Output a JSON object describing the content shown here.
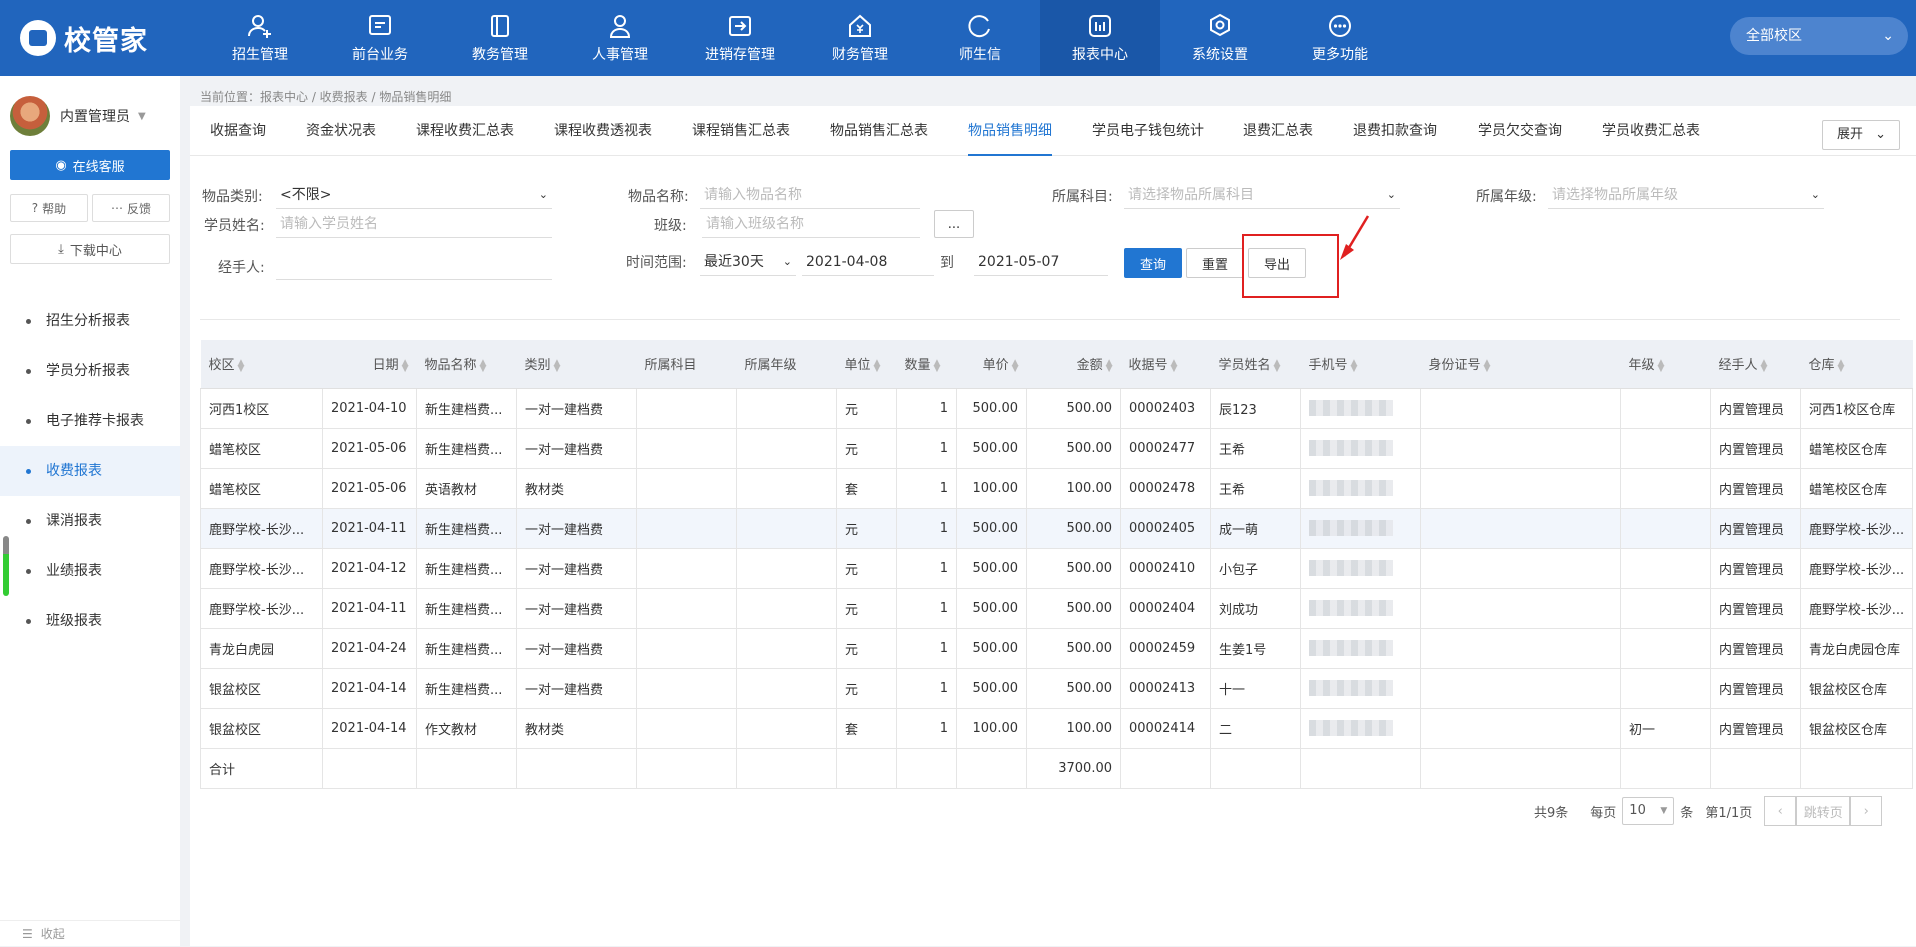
{
  "app": {
    "logo_text": "校管家",
    "campus_select": "全部校区"
  },
  "nav": [
    {
      "label": "招生管理",
      "icon": "user-plus-icon"
    },
    {
      "label": "前台业务",
      "icon": "monitor-icon"
    },
    {
      "label": "教务管理",
      "icon": "book-icon"
    },
    {
      "label": "人事管理",
      "icon": "person-icon"
    },
    {
      "label": "进销存管理",
      "icon": "inventory-icon"
    },
    {
      "label": "财务管理",
      "icon": "yuan-house-icon"
    },
    {
      "label": "师生信",
      "icon": "chat-icon"
    },
    {
      "label": "报表中心",
      "icon": "chart-icon",
      "active": true
    },
    {
      "label": "系统设置",
      "icon": "gear-icon"
    },
    {
      "label": "更多功能",
      "icon": "more-icon"
    }
  ],
  "sidebar": {
    "user_name": "内置管理员",
    "service_label": "在线客服",
    "help_label": "帮助",
    "feedback_label": "反馈",
    "download_label": "下载中心",
    "menu": [
      "招生分析报表",
      "学员分析报表",
      "电子推荐卡报表",
      "收费报表",
      "课消报表",
      "业绩报表",
      "班级报表"
    ],
    "active_menu": "收费报表",
    "collapse_label": "收起"
  },
  "breadcrumb": "当前位置：报表中心 / 收费报表 / 物品销售明细",
  "tabs": [
    "收据查询",
    "资金状况表",
    "课程收费汇总表",
    "课程收费透视表",
    "课程销售汇总表",
    "物品销售汇总表",
    "物品销售明细",
    "学员电子钱包统计",
    "退费汇总表",
    "退费扣款查询",
    "学员欠交查询",
    "学员收费汇总表"
  ],
  "active_tab": "物品销售明细",
  "expand_label": "展开",
  "filters": {
    "category_label": "物品类别:",
    "category_value": "<不限>",
    "item_name_label": "物品名称:",
    "item_name_placeholder": "请输入物品名称",
    "subject_label": "所属科目:",
    "subject_placeholder": "请选择物品所属科目",
    "grade_label": "所属年级:",
    "grade_placeholder": "请选择物品所属年级",
    "student_label": "学员姓名:",
    "student_placeholder": "请输入学员姓名",
    "class_label": "班级:",
    "class_placeholder": "请输入班级名称",
    "class_more": "...",
    "handler_label": "经手人:",
    "time_label": "时间范围:",
    "time_preset": "最近30天",
    "date_from": "2021-04-08",
    "to_label": "到",
    "date_to": "2021-05-07",
    "query_label": "查询",
    "reset_label": "重置",
    "export_label": "导出"
  },
  "table": {
    "columns": [
      "校区",
      "日期",
      "物品名称",
      "类别",
      "所属科目",
      "所属年级",
      "单位",
      "数量",
      "单价",
      "金额",
      "收据号",
      "学员姓名",
      "手机号",
      "身份证号",
      "年级",
      "经手人",
      "仓库"
    ],
    "rows": [
      [
        "河西1校区",
        "2021-04-10",
        "新生建档费...",
        "一对一建档费",
        "",
        "",
        "元",
        "1",
        "500.00",
        "500.00",
        "00002403",
        "辰123",
        "",
        "",
        "",
        "内置管理员",
        "河西1校区仓库"
      ],
      [
        "蜡笔校区",
        "2021-05-06",
        "新生建档费...",
        "一对一建档费",
        "",
        "",
        "元",
        "1",
        "500.00",
        "500.00",
        "00002477",
        "王希",
        "",
        "",
        "",
        "内置管理员",
        "蜡笔校区仓库"
      ],
      [
        "蜡笔校区",
        "2021-05-06",
        "英语教材",
        "教材类",
        "",
        "",
        "套",
        "1",
        "100.00",
        "100.00",
        "00002478",
        "王希",
        "",
        "",
        "",
        "内置管理员",
        "蜡笔校区仓库"
      ],
      [
        "鹿野学校-长沙...",
        "2021-04-11",
        "新生建档费...",
        "一对一建档费",
        "",
        "",
        "元",
        "1",
        "500.00",
        "500.00",
        "00002405",
        "成一萌",
        "",
        "",
        "",
        "内置管理员",
        "鹿野学校-长沙..."
      ],
      [
        "鹿野学校-长沙...",
        "2021-04-12",
        "新生建档费...",
        "一对一建档费",
        "",
        "",
        "元",
        "1",
        "500.00",
        "500.00",
        "00002410",
        "小包子",
        "",
        "",
        "",
        "内置管理员",
        "鹿野学校-长沙..."
      ],
      [
        "鹿野学校-长沙...",
        "2021-04-11",
        "新生建档费...",
        "一对一建档费",
        "",
        "",
        "元",
        "1",
        "500.00",
        "500.00",
        "00002404",
        "刘成功",
        "",
        "",
        "",
        "内置管理员",
        "鹿野学校-长沙..."
      ],
      [
        "青龙白虎园",
        "2021-04-24",
        "新生建档费...",
        "一对一建档费",
        "",
        "",
        "元",
        "1",
        "500.00",
        "500.00",
        "00002459",
        "生姜1号",
        "",
        "",
        "",
        "内置管理员",
        "青龙白虎园仓库"
      ],
      [
        "银盆校区",
        "2021-04-14",
        "新生建档费...",
        "一对一建档费",
        "",
        "",
        "元",
        "1",
        "500.00",
        "500.00",
        "00002413",
        "十一",
        "",
        "",
        "",
        "内置管理员",
        "银盆校区仓库"
      ],
      [
        "银盆校区",
        "2021-04-14",
        "作文教材",
        "教材类",
        "",
        "",
        "套",
        "1",
        "100.00",
        "100.00",
        "00002414",
        "二",
        "",
        "",
        "初一",
        "内置管理员",
        "银盆校区仓库"
      ]
    ],
    "total_label": "合计",
    "total_amount": "3700.00"
  },
  "pagination": {
    "total": "共9条",
    "per_page_label": "每页",
    "per_page": "10",
    "unit": "条",
    "page_info": "第1/1页",
    "jump_label": "跳转页"
  },
  "colors": {
    "topbar": "#2165bd",
    "accent": "#2176d2",
    "highlight": "#e02020"
  }
}
